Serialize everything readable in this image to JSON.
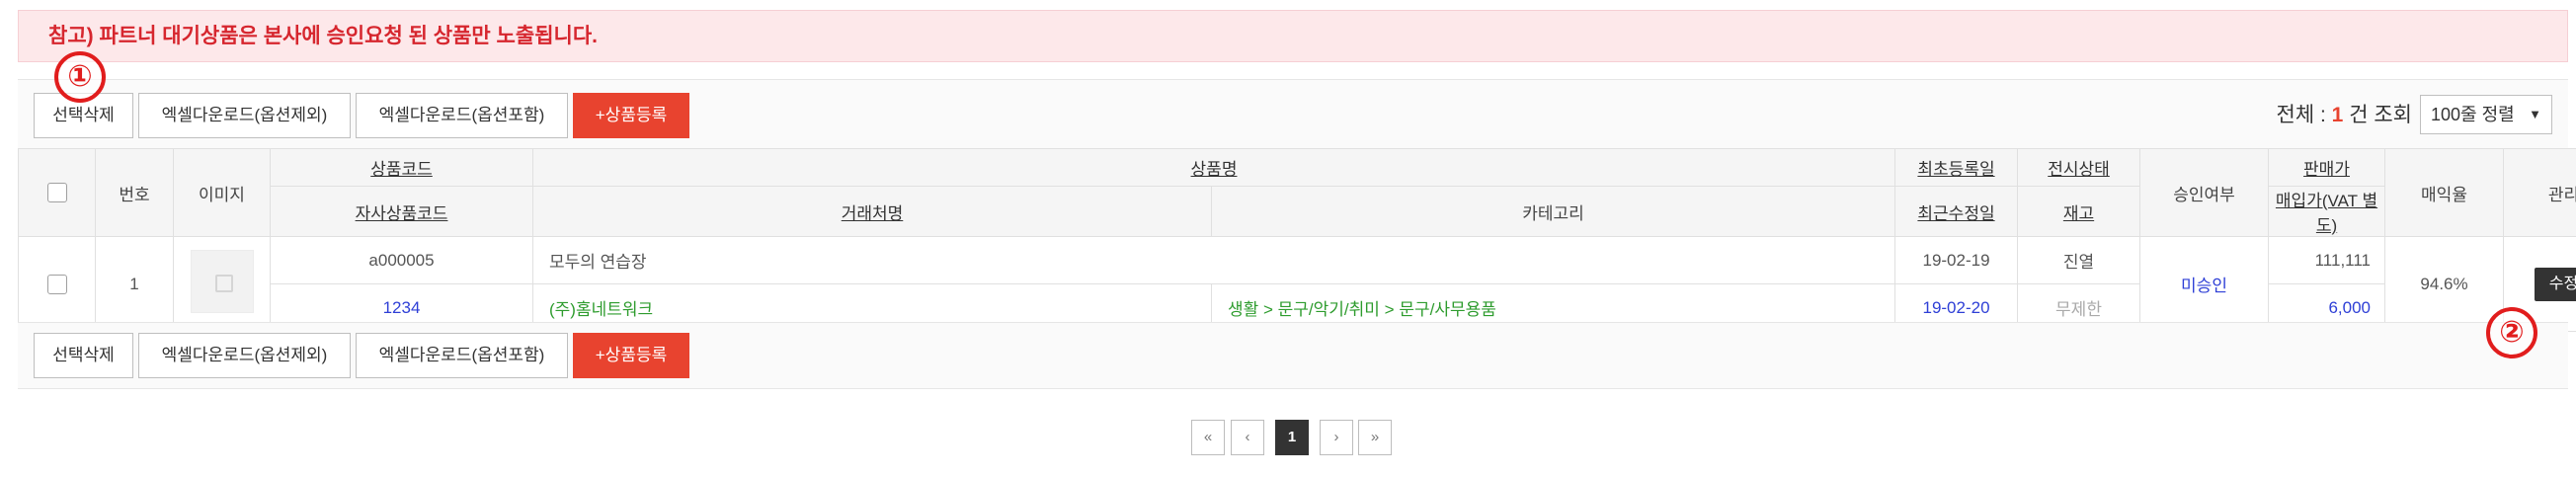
{
  "notice": "참고) 파트너 대기상품은 본사에 승인요청 된 상품만 노출됩니다.",
  "markers": {
    "one": "①",
    "two": "②"
  },
  "toolbar": {
    "delete_label": "선택삭제",
    "excel_no_option": "엑셀다운로드(옵션제외)",
    "excel_with_option": "엑셀다운로드(옵션포함)",
    "add_product": "+상품등록",
    "total_prefix": "전체 : ",
    "total_count": "1",
    "total_suffix": " 건 조회",
    "sort_value": "100줄 정렬",
    "sort_arrow": "▼"
  },
  "table": {
    "headers": {
      "no": "번호",
      "image": "이미지",
      "product_code": "상품코드",
      "own_code": "자사상품코드",
      "product_name": "상품명",
      "vendor": "거래처명",
      "category": "카테고리",
      "first_reg": "최초등록일",
      "last_mod": "최근수정일",
      "display_status": "전시상태",
      "stock": "재고",
      "approval": "승인여부",
      "price": "판매가",
      "cost": "매입가(VAT 별도)",
      "margin": "매익율",
      "manage": "관리"
    },
    "row": {
      "no": "1",
      "product_code": "a000005",
      "product_name": "모두의 연습장",
      "first_reg": "19-02-19",
      "display_status": "진열",
      "approval": "미승인",
      "price": "111,111",
      "margin": "94.6%",
      "edit": "수정",
      "own_code": "1234",
      "vendor": "(주)홈네트워크",
      "category": "생활 > 문구/악기/취미 > 문구/사무용품",
      "last_mod": "19-02-20",
      "stock": "무제한",
      "cost": "6,000"
    }
  },
  "pagination": {
    "first": "«",
    "prev": "‹",
    "current": "1",
    "next": "›",
    "last": "»"
  }
}
